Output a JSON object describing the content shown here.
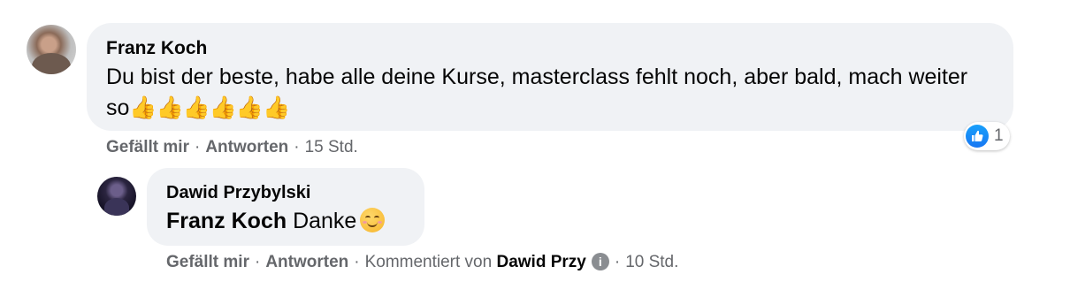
{
  "comment": {
    "author": "Franz Koch",
    "text": "Du bist der beste, habe alle deine Kurse, masterclass fehlt noch, aber bald, mach weiter so",
    "emoji": "👍👍👍👍👍👍",
    "actions": {
      "like": "Gefällt mir",
      "sep1": "·",
      "reply": "Antworten",
      "sep2": "·",
      "time": "15 Std."
    },
    "reactions": {
      "icon": "like-icon",
      "count": "1",
      "color": "#1877f2"
    }
  },
  "reply": {
    "author": "Dawid Przybylski",
    "mention": "Franz Koch",
    "text": " Danke",
    "emoji": "smiling-face-icon",
    "actions": {
      "like": "Gefällt mir",
      "sep1": "·",
      "reply": "Antworten",
      "sep2": "·",
      "commented_by": "Kommentiert von",
      "commenter": "Dawid Przy",
      "sep3": "·",
      "time": "10 Std."
    }
  }
}
